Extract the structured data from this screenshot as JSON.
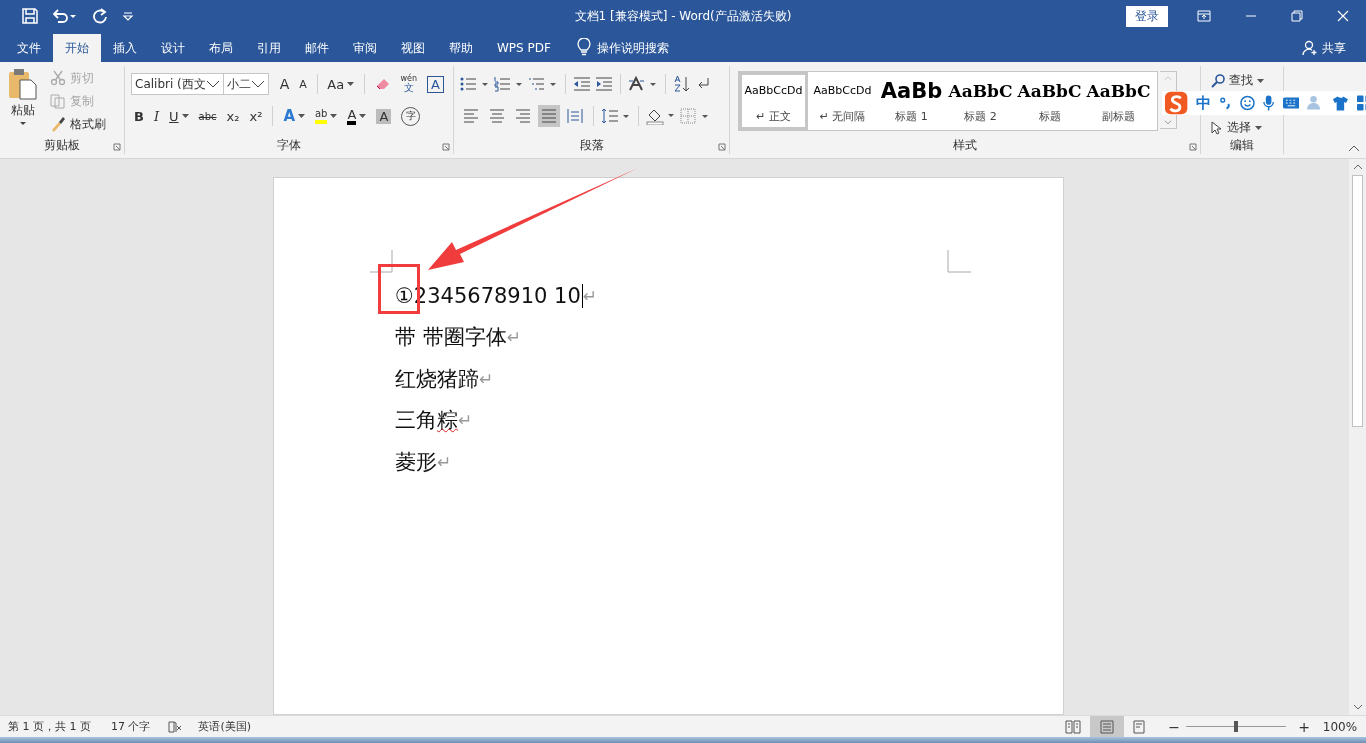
{
  "window": {
    "title": "文档1 [兼容模式]  -  Word(产品激活失败)",
    "login": "登录"
  },
  "tabs": [
    {
      "label": "文件",
      "selected": false
    },
    {
      "label": "开始",
      "selected": true
    },
    {
      "label": "插入",
      "selected": false
    },
    {
      "label": "设计",
      "selected": false
    },
    {
      "label": "布局",
      "selected": false
    },
    {
      "label": "引用",
      "selected": false
    },
    {
      "label": "邮件",
      "selected": false
    },
    {
      "label": "审阅",
      "selected": false
    },
    {
      "label": "视图",
      "selected": false
    },
    {
      "label": "帮助",
      "selected": false
    },
    {
      "label": "WPS PDF",
      "selected": false
    }
  ],
  "tell_me": "操作说明搜索",
  "share": "共享",
  "clipboard": {
    "paste": "粘贴",
    "items": [
      {
        "label": "剪切",
        "kind": "cut",
        "disabled": true
      },
      {
        "label": "复制",
        "kind": "copy",
        "disabled": true
      },
      {
        "label": "格式刷",
        "kind": "painter",
        "disabled": false
      }
    ],
    "group": "剪贴板"
  },
  "font": {
    "name": "Calibri (西文",
    "size": "小二",
    "group": "字体",
    "row1": [
      {
        "kind": "grow",
        "text": "A"
      },
      {
        "kind": "shrink",
        "text": "A"
      },
      {
        "kind": "case",
        "text": "Aa",
        "caret": true
      },
      {
        "kind": "clear"
      },
      {
        "kind": "phonetic",
        "ruby": "wén",
        "text": "文"
      },
      {
        "kind": "border",
        "text": "A"
      }
    ],
    "row2": [
      {
        "kind": "bold",
        "text": "B"
      },
      {
        "kind": "italic",
        "text": "I"
      },
      {
        "kind": "underline",
        "text": "U",
        "caret": true
      },
      {
        "kind": "strike",
        "text": "abc"
      },
      {
        "kind": "sub",
        "text": "x₂"
      },
      {
        "kind": "sup",
        "text": "x²"
      },
      {
        "kind": "effects",
        "text": "A",
        "caret": true
      },
      {
        "kind": "highlight",
        "text": "ab",
        "caret": true
      },
      {
        "kind": "color",
        "text": "A",
        "caret": true
      },
      {
        "kind": "shading",
        "text": "A"
      },
      {
        "kind": "enclose",
        "text": "字"
      }
    ]
  },
  "paragraph": {
    "group": "段落",
    "alignments": [
      {
        "selected": false
      },
      {
        "selected": false
      },
      {
        "selected": false
      },
      {
        "selected": true
      },
      {
        "selected": false
      }
    ]
  },
  "styles": {
    "group": "样式",
    "items": [
      {
        "preview": "AaBbCcDd",
        "name": "↵ 正文",
        "kind": "body",
        "selected": true
      },
      {
        "preview": "AaBbCcDd",
        "name": "↵ 无间隔",
        "kind": "body",
        "selected": false
      },
      {
        "preview": "AaBb",
        "name": "标题 1",
        "kind": "heading1",
        "selected": false
      },
      {
        "preview": "AaBbC",
        "name": "标题 2",
        "kind": "heading2",
        "selected": false
      },
      {
        "preview": "AaBbC",
        "name": "标题",
        "kind": "title",
        "selected": false
      },
      {
        "preview": "AaBbC",
        "name": "副标题",
        "kind": "subtitle",
        "selected": false
      }
    ]
  },
  "editing": {
    "find": "查找",
    "select": "选择",
    "group": "编辑"
  },
  "ime": {
    "mode": "中"
  },
  "document": {
    "mark": "↵",
    "lines": [
      {
        "text": "①2345678910 10",
        "cursor": true
      },
      {
        "text": "带  带圈字体",
        "cursor": false
      },
      {
        "text": "红烧猪蹄",
        "cursor": false
      },
      {
        "text": "三角",
        "flagged": "粽",
        "cursor": false
      },
      {
        "text": "菱形",
        "cursor": false
      }
    ]
  },
  "status_bar": {
    "items": [
      "第 1 页，共 1 页",
      "17 个字",
      "英语(美国)"
    ],
    "views": [
      {
        "selected": false
      },
      {
        "selected": true
      },
      {
        "selected": false
      }
    ],
    "zoom_out": "−",
    "zoom_in": "+",
    "level": 0.5,
    "zoom": "100%"
  }
}
